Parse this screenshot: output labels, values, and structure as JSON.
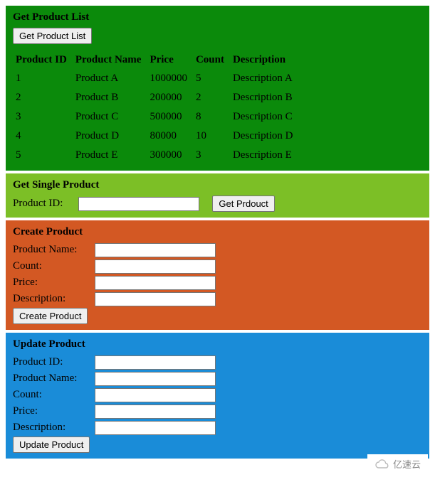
{
  "list": {
    "title": "Get Product List",
    "button": "Get Product List",
    "headers": {
      "id": "Product ID",
      "name": "Product Name",
      "price": "Price",
      "count": "Count",
      "desc": "Description"
    },
    "rows": [
      {
        "id": "1",
        "name": "Product A",
        "price": "1000000",
        "count": "5",
        "desc": "Description A"
      },
      {
        "id": "2",
        "name": "Product B",
        "price": "200000",
        "count": "2",
        "desc": "Description B"
      },
      {
        "id": "3",
        "name": "Product C",
        "price": "500000",
        "count": "8",
        "desc": "Description C"
      },
      {
        "id": "4",
        "name": "Product D",
        "price": "80000",
        "count": "10",
        "desc": "Description D"
      },
      {
        "id": "5",
        "name": "Product E",
        "price": "300000",
        "count": "3",
        "desc": "Description E"
      }
    ]
  },
  "single": {
    "title": "Get Single Product",
    "id_label": "Product ID:",
    "id_value": "",
    "button": "Get Prdouct"
  },
  "create": {
    "title": "Create Product",
    "name_label": "Product Name:",
    "name_value": "",
    "count_label": "Count:",
    "count_value": "",
    "price_label": "Price:",
    "price_value": "",
    "desc_label": "Description:",
    "desc_value": "",
    "button": "Create Product"
  },
  "update": {
    "title": "Update Product",
    "id_label": "Product ID:",
    "id_value": "",
    "name_label": "Product Name:",
    "name_value": "",
    "count_label": "Count:",
    "count_value": "",
    "price_label": "Price:",
    "price_value": "",
    "desc_label": "Description:",
    "desc_value": "",
    "button": "Update Product"
  },
  "watermark": "亿速云"
}
